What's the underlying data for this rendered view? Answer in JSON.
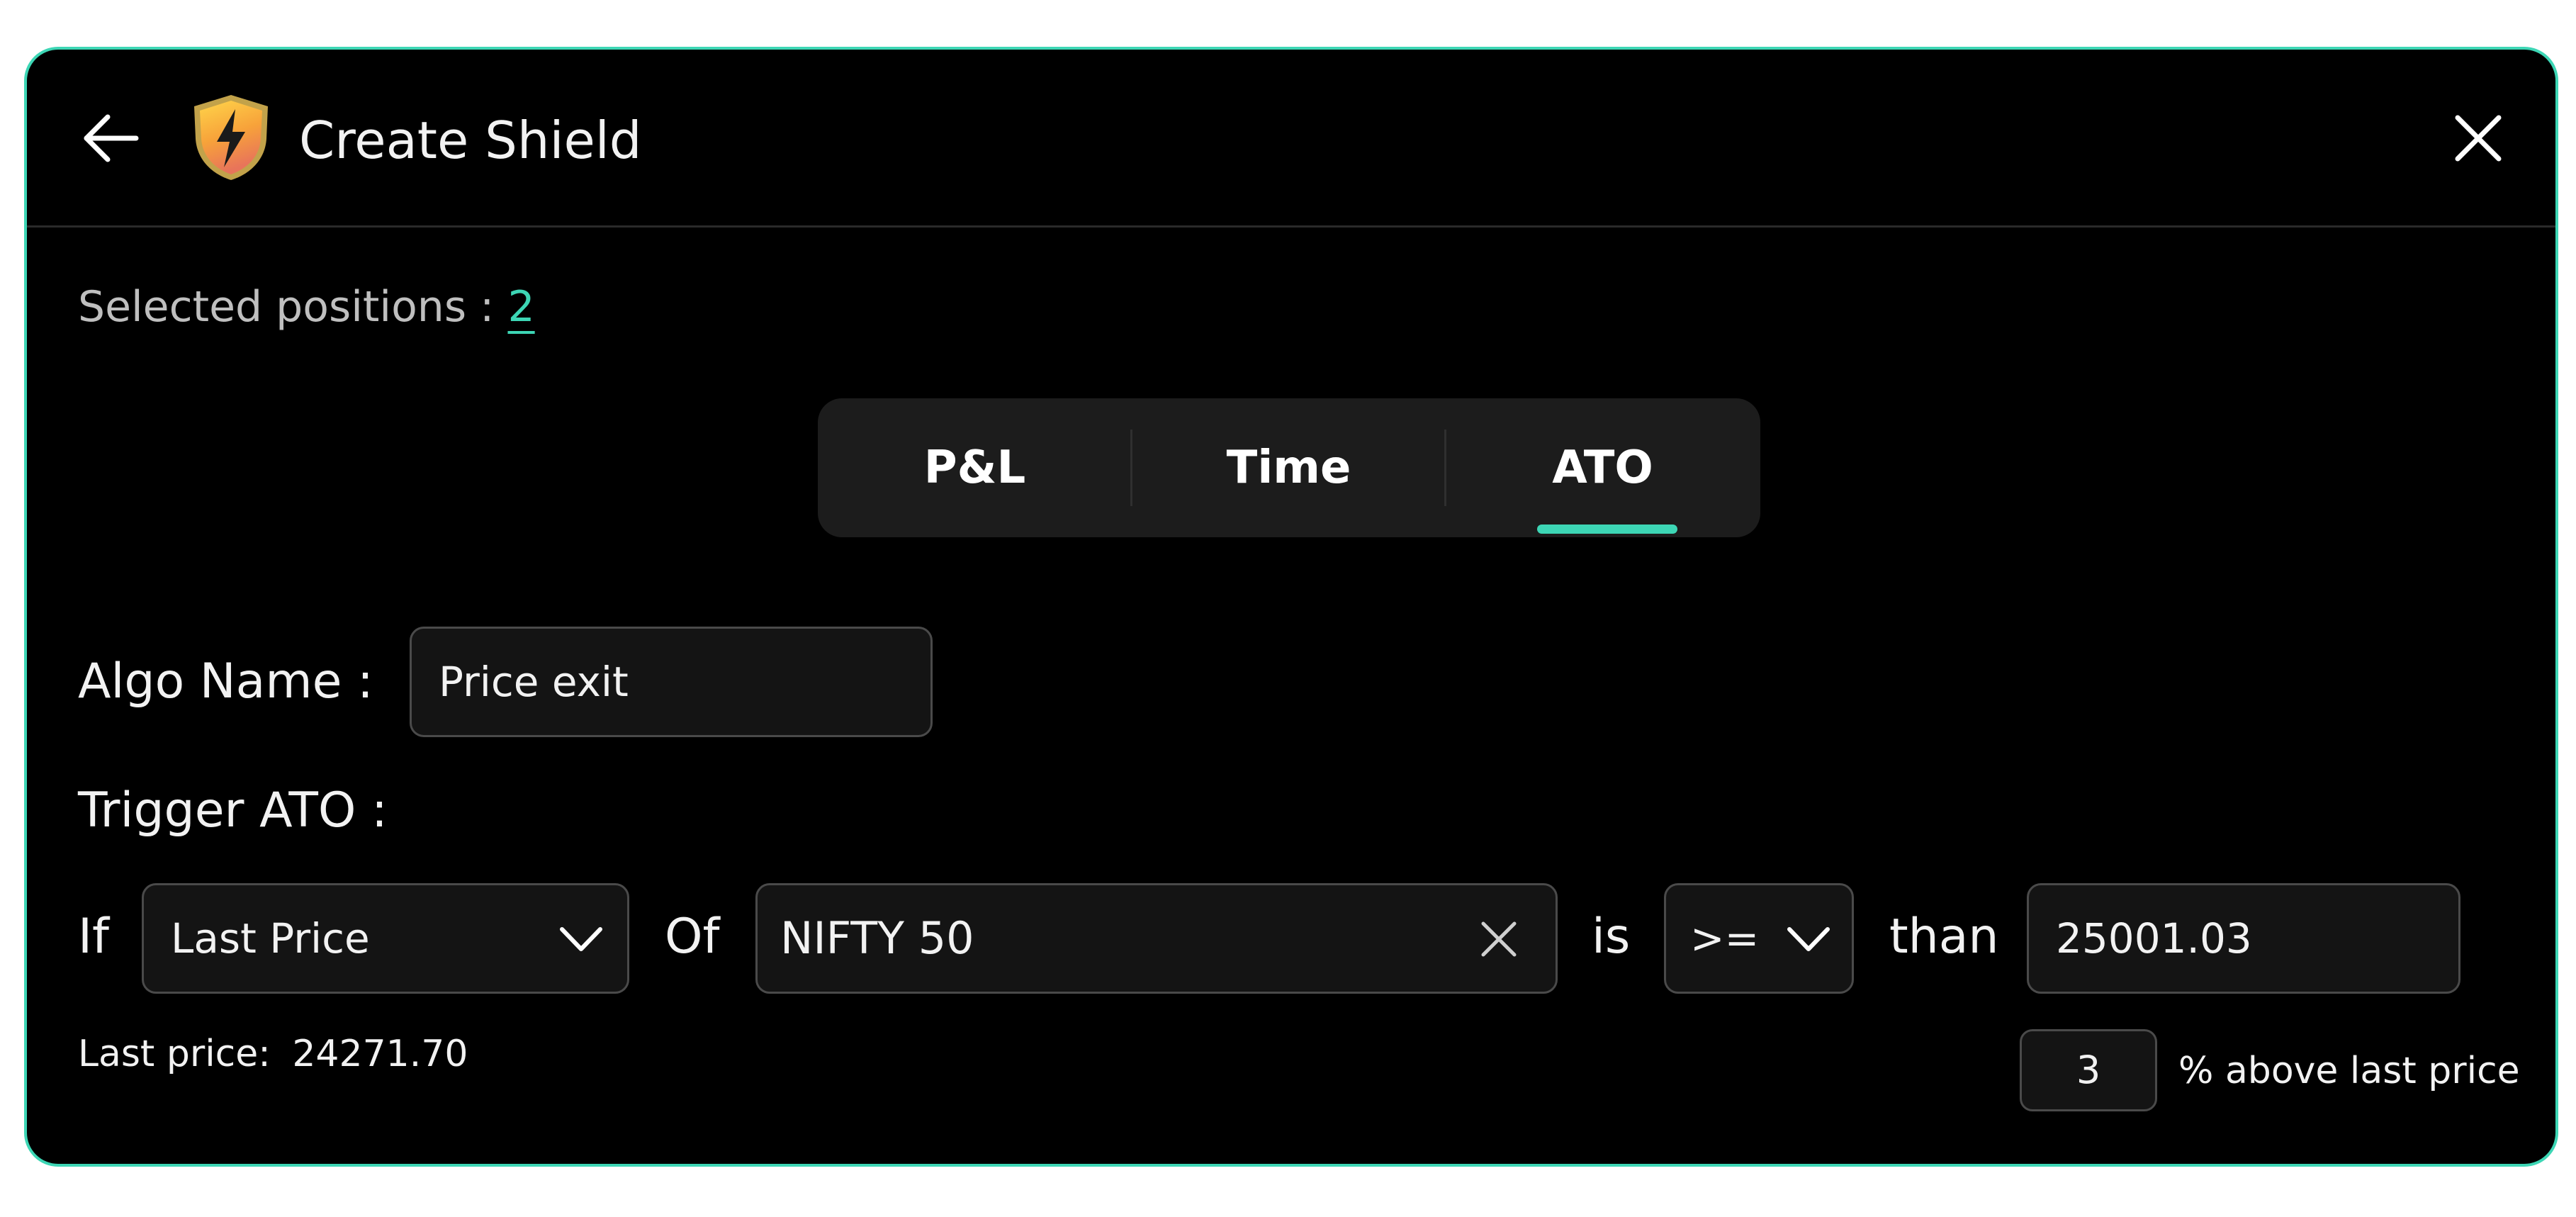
{
  "header": {
    "title": "Create Shield"
  },
  "selected_positions": {
    "label": "Selected positions :",
    "count": "2"
  },
  "tabs": [
    {
      "label": "P&L",
      "active": false
    },
    {
      "label": "Time",
      "active": false
    },
    {
      "label": "ATO",
      "active": true
    }
  ],
  "algo": {
    "label": "Algo Name :",
    "value": "Price exit"
  },
  "trigger": {
    "label": "Trigger ATO :",
    "if_label": "If",
    "metric_value": "Last Price",
    "of_label": "Of",
    "instrument_value": "NIFTY 50",
    "is_label": "is",
    "operator_value": ">=",
    "than_label": "than",
    "threshold_value": "25001.03"
  },
  "last_price": {
    "label": "Last price:",
    "value": "24271.70"
  },
  "percent": {
    "value": "3",
    "suffix": "% above last price"
  },
  "colors": {
    "accent": "#3dd6b5",
    "background": "#000000",
    "field_background": "#141414",
    "field_border": "#4a4a4a",
    "tabs_background": "#1c1c1c"
  },
  "icons": {
    "back": "arrow-left-icon",
    "logo": "shield-lightning-icon",
    "close": "close-icon",
    "dropdown": "chevron-down-icon",
    "clear": "clear-x-icon"
  }
}
